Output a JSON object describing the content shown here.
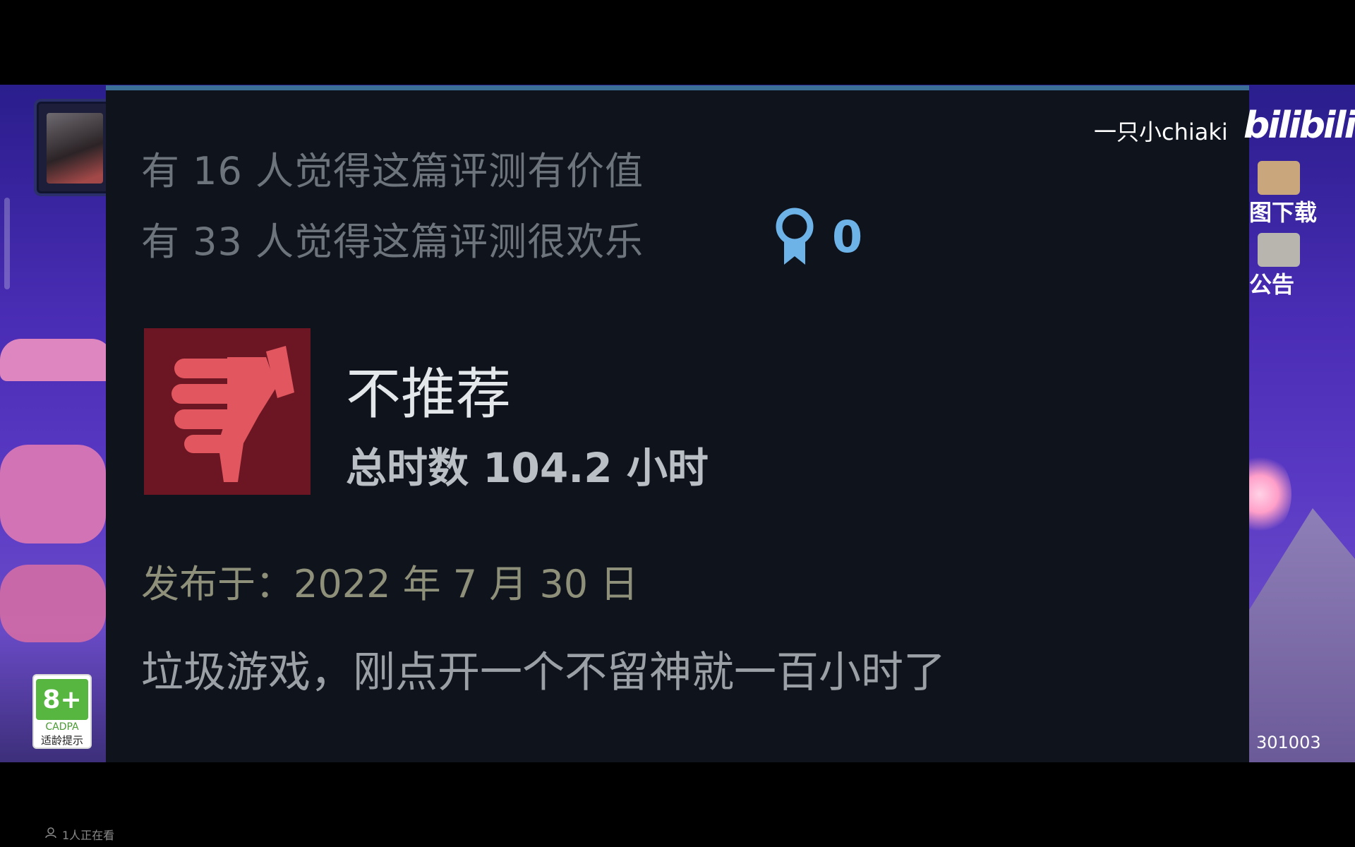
{
  "panel": {
    "helpful_line": "有 16 人觉得这篇评测有价值",
    "funny_line": "有 33 人觉得这篇评测很欢乐",
    "award_count": "0",
    "verdict": "不推荐",
    "hours": "总时数 104.2 小时",
    "posted": "发布于：2022 年 7 月 30 日",
    "review_text": "垃圾游戏，刚点开一个不留神就一百小时了"
  },
  "overlay": {
    "uploader": "一只小chiaki",
    "logo_text": "bilibili",
    "side_items": [
      {
        "label": "图下载",
        "icon": "map-sticker-icon"
      },
      {
        "label": "公告",
        "icon": "character-sticker-icon"
      }
    ],
    "age_rating": {
      "badge": "8+",
      "org": "CADPA",
      "tip": "适龄提示"
    },
    "code": "301003"
  },
  "player": {
    "viewers": "1人正在看"
  },
  "colors": {
    "panel_bg": "#0f131c",
    "panel_top_border": "#3b6f96",
    "thumb_bg": "#6b1622",
    "thumb_fg": "#e2565f",
    "award_blue": "#6db3e8"
  }
}
